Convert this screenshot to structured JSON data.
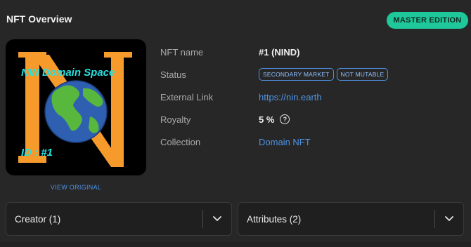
{
  "header": {
    "title": "NFT Overview",
    "edition_badge": "MASTER EDITION"
  },
  "image": {
    "overlay_title": "NIN Domain Space",
    "overlay_id": "ID : #1",
    "view_original": "VIEW ORIGINAL"
  },
  "details": {
    "nft_name": {
      "label": "NFT name",
      "value": "#1 (NIND)"
    },
    "status": {
      "label": "Status",
      "tags": [
        "SECONDARY MARKET",
        "NOT MUTABLE"
      ]
    },
    "external_link": {
      "label": "External Link",
      "value": "https://nin.earth"
    },
    "royalty": {
      "label": "Royalty",
      "value": "5 %",
      "help_icon": "?"
    },
    "collection": {
      "label": "Collection",
      "value": "Domain NFT"
    }
  },
  "panels": {
    "creator": "Creator (1)",
    "attributes": "Attributes (2)"
  },
  "colors": {
    "accent": "#1ec89a",
    "link": "#4f93e6",
    "background": "#272727",
    "letter": "#f59a2b",
    "overlay_text": "#27e0e0"
  }
}
